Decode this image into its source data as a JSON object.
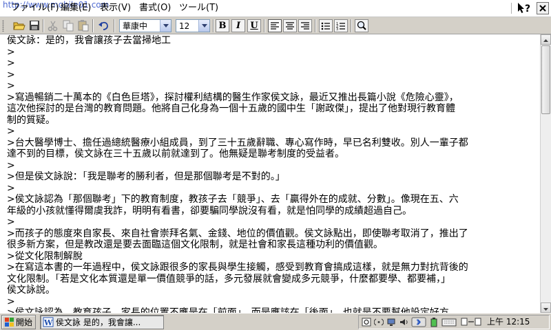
{
  "menubar": {
    "watermark": "http://www.mobile01.com",
    "items": [
      {
        "label": "ファイル(F)"
      },
      {
        "label": "編集(E)"
      },
      {
        "label": "表示(V)"
      },
      {
        "label": "書式(O)"
      },
      {
        "label": "ツール(T)"
      }
    ],
    "help_icon": "help-pointer-icon",
    "close_icon": "close-icon"
  },
  "toolbar": {
    "font_name": "華康中",
    "font_size": "12",
    "bold_label": "B",
    "italic_label": "I",
    "underline_label": "U",
    "icons": [
      "open-folder-icon",
      "save-icon",
      "cut-icon",
      "copy-icon",
      "paste-icon",
      "undo-icon",
      "align-left-icon",
      "align-center-icon",
      "align-right-icon",
      "bullets-icon",
      "numbering-icon",
      "zoom-icon"
    ]
  },
  "document": {
    "lines": [
      "侯文詠：是的，我會讓孩子去當掃地工",
      ">",
      ">",
      ">",
      ">",
      ">寫過暢銷二十萬本的《白色巨塔》，探討權利結構的醫生作家侯文詠，最近又推出長篇小說《危險心靈》，",
      "這次他探討的是台灣的教育問題。他將自己化身為一個十五歲的國中生「謝政傑」，提出了他對現行教育體",
      "制的質疑。",
      ">",
      ">台大醫學博士、擔任過總統醫療小組成員，到了三十五歲辭職、專心寫作時，早已名利雙收。別人一輩子都",
      "達不到的目標，侯文詠在三十五歲以前就達到了。他無疑是聯考制度的受益者。",
      ">",
      ">但是侯文詠說：「我是聯考的勝利者，但是那個聯考是不對的。」",
      ">",
      ">侯文詠認為「那個聯考」下的教育制度，教孩子去「競爭」、去「贏得外在的成就、分數」。像現在五、六",
      "年級的小孩就懂得爾虞我詐，明明有看書，卻要騙同學說沒有看，就是怕同學的成績超過自己。",
      ">",
      ">而孩子的態度來自家長、來自社會崇拜名氣、金錢、地位的價值觀。侯文詠點出，即使聯考取消了，推出了",
      "很多新方案，但是教改還是要去面臨這個文化限制，就是社會和家長這種功利的價值觀。",
      ">從文化限制解脫",
      ">在寫這本書的一年過程中，侯文詠跟很多的家長與學生接觸，感受到教育會搞成這樣，就是無力對抗背後的",
      "文化限制。「若是文化本質還是單一價值競爭的話，多元發展就會變成多元競爭，什麼都要學、都要補，」",
      "侯文詠說。",
      ">",
      ">侯文詠認為，教育孩子，家長的位置不應是在「前面」，而是應該在「後面」，也就是不要幫他設定好方"
    ]
  },
  "taskbar": {
    "start_label": "開始",
    "task_label": "侯文詠 是的，我會讓...",
    "clock": "上午 12:15",
    "tray_icons": [
      "input-method-icon",
      "wireless-icon",
      "network-icon",
      "volume-icon",
      "bluetooth-icon",
      "battery-icon",
      "keyboard-icon",
      "connection-icon"
    ]
  }
}
